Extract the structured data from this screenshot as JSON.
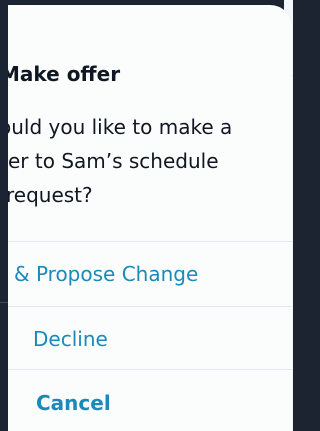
{
  "dialog": {
    "title": "Make offer",
    "message_lines": [
      "ould you like to make a",
      "er to Sam’s schedule",
      "request?"
    ],
    "actions": {
      "propose": "& Propose Change",
      "decline": "Decline",
      "cancel": "Cancel"
    }
  },
  "colors": {
    "accent": "#1b8ab8",
    "title": "#0f1722",
    "sheet_bg": "#fbfcfc",
    "backdrop": "#1a2433"
  }
}
